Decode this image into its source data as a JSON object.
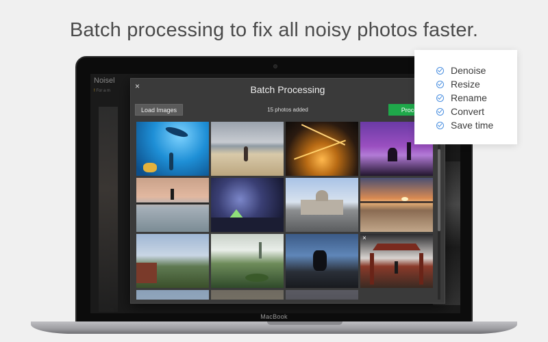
{
  "headline": "Batch processing to fix all noisy photos faster.",
  "background_app": {
    "title": "Noisel",
    "subtitle_prefix": "!",
    "subtitle": "For a m"
  },
  "dialog": {
    "close_label": "×",
    "title": "Batch Processing",
    "load_button": "Load Images",
    "count_text": "15 photos added",
    "process_button": "Process",
    "remove_label": "×",
    "thumbnails": [
      {
        "name": "underwater-shark"
      },
      {
        "name": "beach-woman"
      },
      {
        "name": "city-night-aerial"
      },
      {
        "name": "purple-sunset-silhouettes"
      },
      {
        "name": "pier-reflection-jump"
      },
      {
        "name": "tent-night-sky"
      },
      {
        "name": "government-building"
      },
      {
        "name": "beach-sunset"
      },
      {
        "name": "lake-village"
      },
      {
        "name": "park-pond-spire"
      },
      {
        "name": "car-interior"
      },
      {
        "name": "pagoda-gate"
      },
      {
        "name": "partial-sky"
      },
      {
        "name": "partial-ground"
      },
      {
        "name": "partial-dark"
      }
    ]
  },
  "laptop_brand": "MacBook",
  "features": {
    "items": [
      {
        "label": "Denoise"
      },
      {
        "label": "Resize"
      },
      {
        "label": "Rename"
      },
      {
        "label": "Convert"
      },
      {
        "label": "Save time"
      }
    ]
  },
  "colors": {
    "process_green": "#1fa84a",
    "check_blue": "#4a8fe0"
  }
}
